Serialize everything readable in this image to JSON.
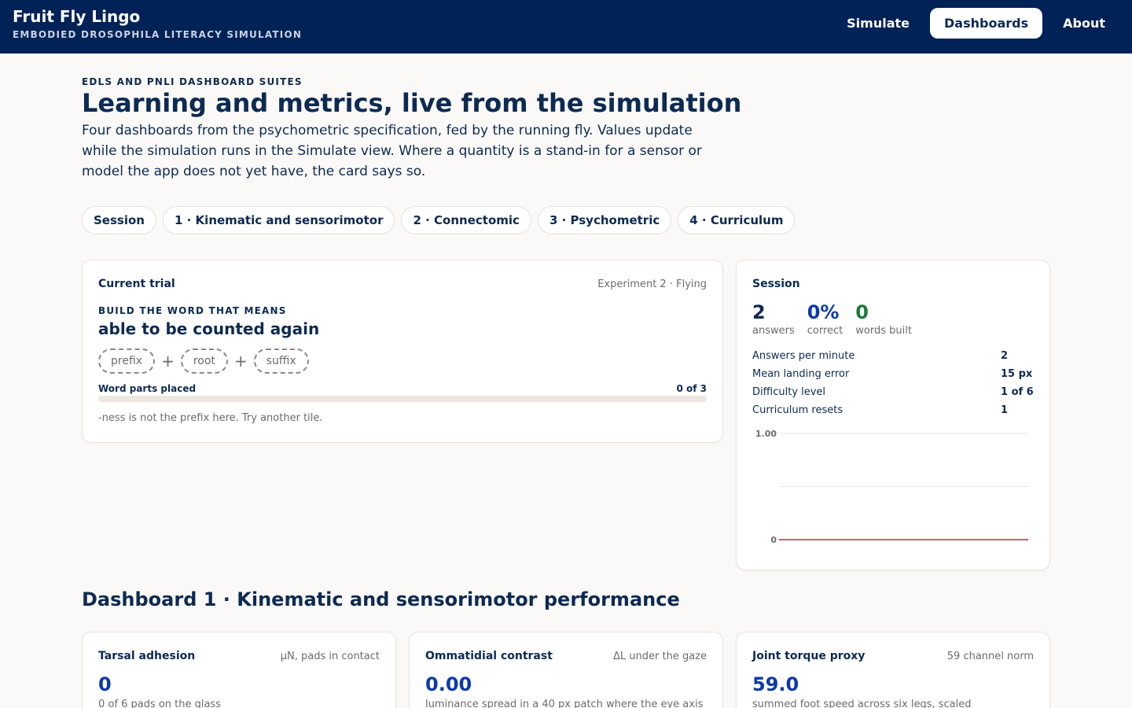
{
  "app": {
    "title": "Fruit Fly Lingo",
    "subtitle": "EMBODIED DROSOPHILA LITERACY SIMULATION"
  },
  "nav": [
    {
      "label": "Simulate",
      "active": false
    },
    {
      "label": "Dashboards",
      "active": true
    },
    {
      "label": "About",
      "active": false
    }
  ],
  "hero": {
    "eyebrow": "EDLS AND PNLI DASHBOARD SUITES",
    "title": "Learning and metrics, live from the simulation",
    "intro": "Four dashboards from the psychometric specification, fed by the running fly. Values update while the simulation runs in the Simulate view. Where a quantity is a stand-in for a sensor or model the app does not yet have, the card says so."
  },
  "tabs": [
    "Session",
    "1 · Kinematic and sensorimotor",
    "2 · Connectomic",
    "3 · Psychometric",
    "4 · Curriculum"
  ],
  "trial": {
    "title": "Current trial",
    "meta": "Experiment 2 · Flying",
    "prompt_label": "BUILD THE WORD THAT MEANS",
    "target_meaning": "able to be counted again",
    "slots": [
      "prefix",
      "root",
      "suffix"
    ],
    "plus": "+",
    "progress_label": "Word parts placed",
    "progress_value": "0 of 3",
    "progress_fraction": 0,
    "feedback": "-ness is not the prefix here. Try another tile."
  },
  "session": {
    "title": "Session",
    "stats": [
      {
        "value": "2",
        "label": "answers"
      },
      {
        "value": "0%",
        "label": "correct"
      },
      {
        "value": "0",
        "label": "words built"
      }
    ],
    "rows": [
      {
        "key": "Answers per minute",
        "value": "2"
      },
      {
        "key": "Mean landing error",
        "value": "15 px"
      },
      {
        "key": "Difficulty level",
        "value": "1 of 6"
      },
      {
        "key": "Curriculum resets",
        "value": "1"
      }
    ]
  },
  "chart_data": {
    "type": "line",
    "y_tick_labels": [
      "1.00",
      "0"
    ],
    "ylim": [
      0,
      1
    ],
    "x": [
      1,
      2
    ],
    "series": [
      {
        "values": [
          0,
          0
        ],
        "color": "#b0353a"
      }
    ],
    "grid": true
  },
  "dashboard1": {
    "title": "Dashboard 1 · Kinematic and sensorimotor performance",
    "cards": [
      {
        "title": "Tarsal adhesion",
        "meta": "μN, pads in contact",
        "value": "0",
        "desc": "0 of 6 pads on the glass"
      },
      {
        "title": "Ommatidial contrast",
        "meta": "ΔL under the gaze",
        "value": "0.00",
        "desc": "luminance spread in a 40 px patch where the eye axis"
      },
      {
        "title": "Joint torque proxy",
        "meta": "59 channel norm",
        "value": "59.0",
        "desc": "summed foot speed across six legs, scaled"
      }
    ]
  }
}
